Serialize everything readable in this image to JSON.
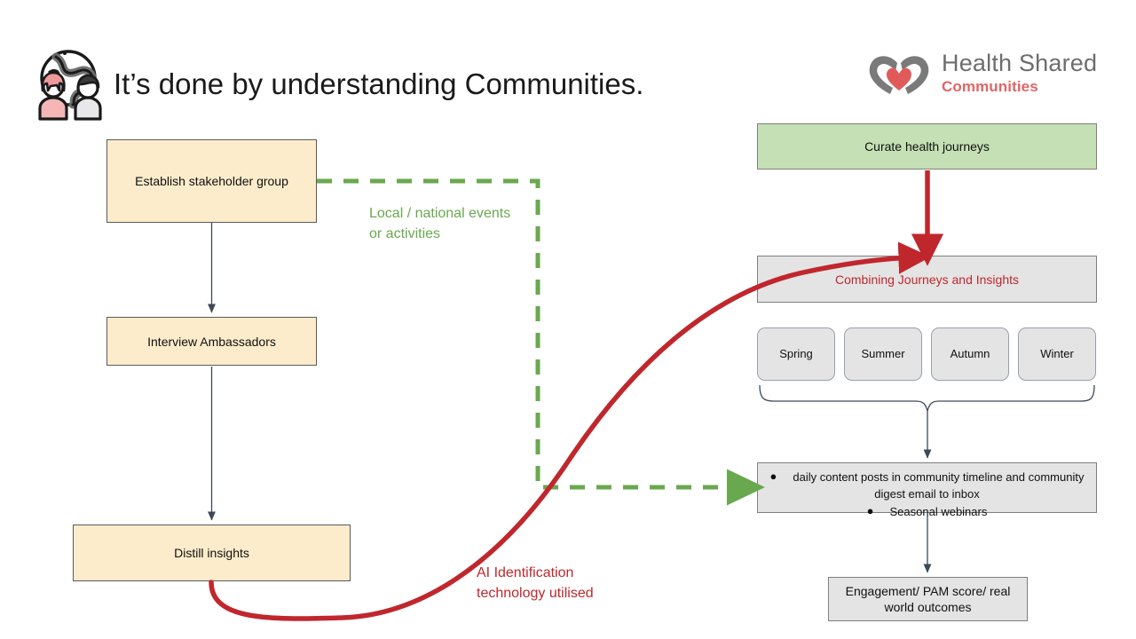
{
  "header": {
    "icon": "community-globe-icon",
    "title": "It’s done by understanding Communities."
  },
  "brand": {
    "mark": "hands-heart-icon",
    "name": "Health Shared",
    "sub": "Communities",
    "name_color": "#6d6d6d",
    "sub_color": "#e06666"
  },
  "left_flow": {
    "boxes": [
      {
        "id": "establish",
        "label": "Establish stakeholder group",
        "fill": "#fdeccb"
      },
      {
        "id": "interview",
        "label": "Interview Ambassadors",
        "fill": "#fdeccb"
      },
      {
        "id": "distill",
        "label": "Distill insights",
        "fill": "#fdeccb"
      }
    ]
  },
  "right_flow": {
    "curate": {
      "label": "Curate health journeys",
      "fill": "#c5e0b4"
    },
    "combining": {
      "label": "Combining Journeys and Insights",
      "fill": "#e4e4e4",
      "text_color": "#c0272d"
    },
    "seasons": [
      {
        "label": "Spring"
      },
      {
        "label": "Summer"
      },
      {
        "label": "Autumn"
      },
      {
        "label": "Winter"
      }
    ],
    "outputs": {
      "bullets": [
        "daily content posts in community timeline and community digest email to inbox",
        "Seasonal webinars"
      ],
      "fill": "#e4e4e4"
    },
    "outcomes": {
      "label": "Engagement/  PAM score/ real world outcomes",
      "fill": "#e4e4e4"
    }
  },
  "annotations": {
    "events_label": "Local / national events or activities",
    "events_color": "#6aa84f",
    "ai_label": "AI Identification technology utilised",
    "ai_color": "#c0272d"
  },
  "colors": {
    "cream": "#fdeccb",
    "green_fill": "#c5e0b4",
    "grey_fill": "#e4e4e4",
    "dashed_green": "#6aa84f",
    "curve_red": "#c0272d",
    "connector_grey": "#3c4858"
  }
}
